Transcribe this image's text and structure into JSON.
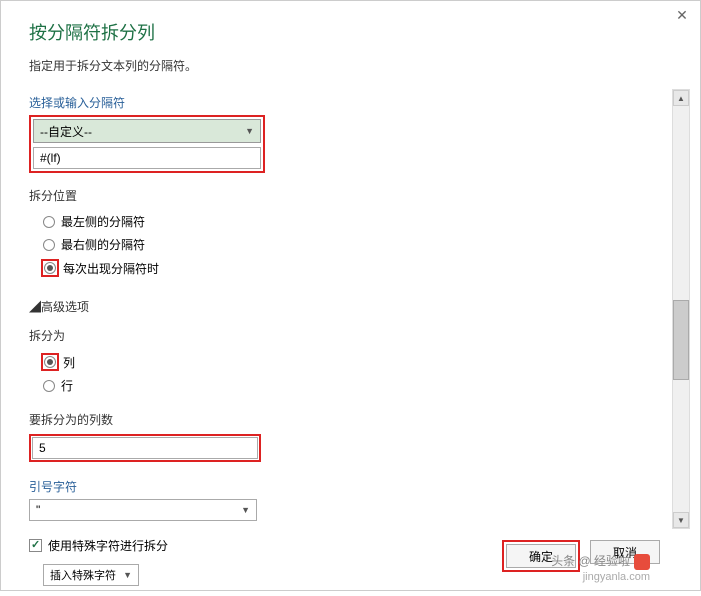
{
  "title": "按分隔符拆分列",
  "subtitle": "指定用于拆分文本列的分隔符。",
  "delimiter": {
    "label": "选择或输入分隔符",
    "selected": "--自定义--",
    "custom_value": "#(lf)"
  },
  "split_position": {
    "label": "拆分位置",
    "options": {
      "leftmost": "最左侧的分隔符",
      "rightmost": "最右侧的分隔符",
      "each": "每次出现分隔符时"
    }
  },
  "advanced": {
    "toggle": "高级选项"
  },
  "split_as": {
    "label": "拆分为",
    "options": {
      "column": "列",
      "row": "行"
    }
  },
  "col_count": {
    "label": "要拆分为的列数",
    "value": "5"
  },
  "quote_char": {
    "label": "引号字符",
    "value": "\""
  },
  "special_chars": {
    "checkbox_label": "使用特殊字符进行拆分",
    "insert_label": "插入特殊字符"
  },
  "buttons": {
    "ok": "确定",
    "cancel": "取消"
  },
  "watermark": {
    "line1": "头条 @ 经验啦",
    "line2": "jingyanla.com"
  }
}
